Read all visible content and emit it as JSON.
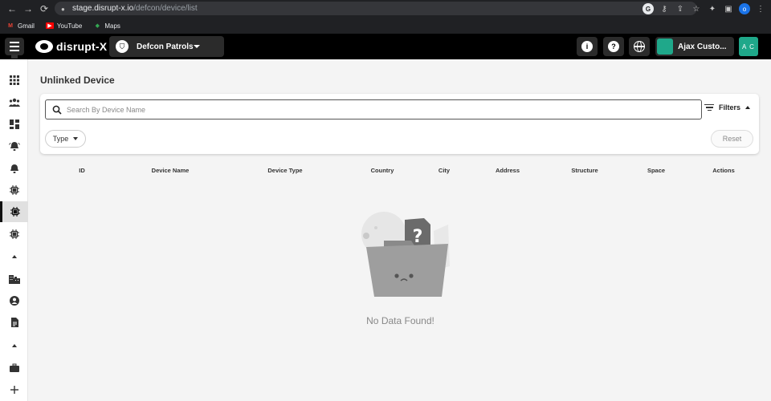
{
  "browser": {
    "url_host": "stage.disrupt-x.io",
    "url_path": "/defcon/device/list",
    "nav": {
      "back_icon": "arrow-left-icon",
      "forward_icon": "arrow-right-icon",
      "reload_icon": "reload-icon"
    },
    "profile_initial": "o"
  },
  "bookmarks": [
    {
      "label": "Gmail",
      "color": "#ea4335"
    },
    {
      "label": "YouTube",
      "color": "#ff0000"
    },
    {
      "label": "Maps",
      "color": "#34a853"
    }
  ],
  "header": {
    "brand": "disrupt-X",
    "org_name": "Defcon Patrols",
    "customer_name": "Ajax Custo...",
    "avatar_initials": "A C",
    "accent_color": "#1fa88a"
  },
  "page": {
    "title": "Unlinked Device",
    "search_placeholder": "Search By Device Name",
    "filters_label": "Filters",
    "type_chip_label": "Type",
    "reset_label": "Reset",
    "columns": [
      "ID",
      "Device Name",
      "Device Type",
      "Country",
      "City",
      "Address",
      "Structure",
      "Space",
      "Actions"
    ],
    "empty_text": "No Data Found!"
  }
}
